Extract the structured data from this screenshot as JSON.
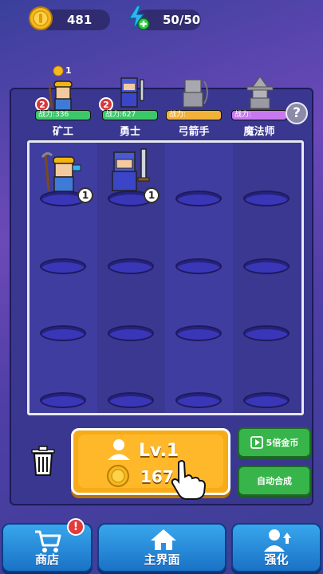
{
  "resources": {
    "coins": "481",
    "energy": "50/50"
  },
  "characters": [
    {
      "power_label": "战力:336",
      "name": "矿工",
      "bar_color": "#3cc86a",
      "badge": "2",
      "coin_reward": "1",
      "unlocked": true
    },
    {
      "power_label": "战力:627",
      "name": "勇士",
      "bar_color": "#3cc86a",
      "badge": "2",
      "unlocked": true
    },
    {
      "power_label": "战力:",
      "name": "弓箭手",
      "bar_color": "#f2b23a",
      "unlocked": false
    },
    {
      "power_label": "战力:",
      "name": "魔法师",
      "bar_color": "#c879f0",
      "unlocked": false
    }
  ],
  "help": "?",
  "grid_units": [
    {
      "unit": "miner",
      "level": "1"
    },
    {
      "unit": "warrior",
      "level": "1"
    }
  ],
  "buy_button": {
    "level_label": "Lv.1",
    "cost": "167"
  },
  "side_buttons": {
    "gold5x_label": "5倍金币",
    "automerge_label": "自动合成"
  },
  "nav": {
    "shop": "商店",
    "home": "主界面",
    "upgrade": "强化",
    "shop_alert": "!"
  },
  "colors": {
    "accent_gold": "#f7ab17",
    "nav_blue": "#2a8ee0",
    "green_button": "#38b54a"
  }
}
